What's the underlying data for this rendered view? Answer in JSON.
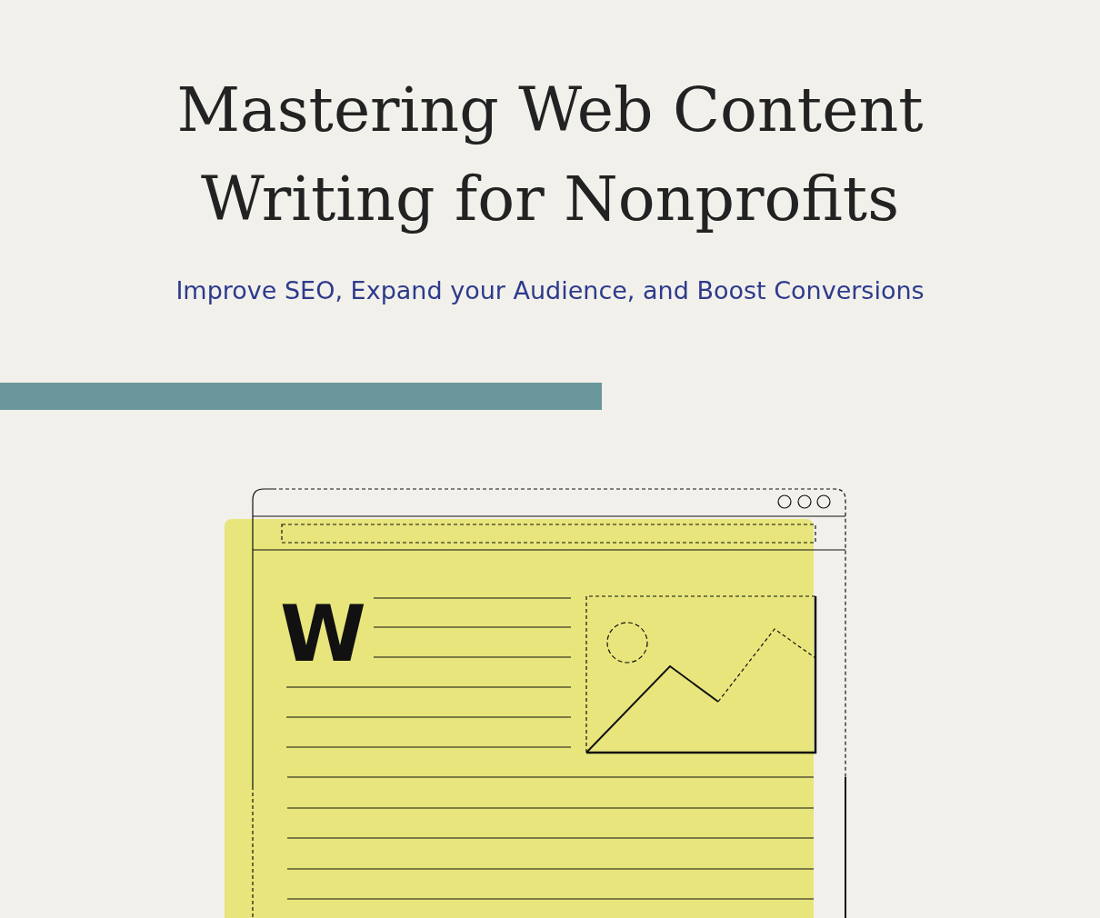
{
  "hero": {
    "title_lines": [
      "Mastering Web Content",
      "Writing for Nonprofits"
    ],
    "subtitle": "Improve SEO, Expand your Audience, and Boost Conversions"
  },
  "illustration": {
    "letter": "W"
  }
}
